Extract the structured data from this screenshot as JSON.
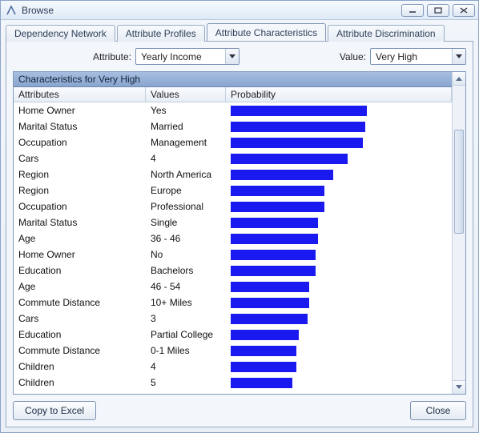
{
  "window": {
    "title": "Browse"
  },
  "tabs": [
    {
      "label": "Dependency Network"
    },
    {
      "label": "Attribute Profiles"
    },
    {
      "label": "Attribute Characteristics"
    },
    {
      "label": "Attribute Discrimination"
    }
  ],
  "controls": {
    "attribute_label": "Attribute:",
    "attribute_value": "Yearly Income",
    "value_label": "Value:",
    "value_value": "Very High"
  },
  "grid": {
    "caption": "Characteristics for Very High",
    "columns": {
      "attr": "Attributes",
      "val": "Values",
      "prob": "Probability"
    },
    "rows": [
      {
        "attr": "Home Owner",
        "val": "Yes",
        "prob": 64
      },
      {
        "attr": "Marital Status",
        "val": "Married",
        "prob": 63
      },
      {
        "attr": "Occupation",
        "val": "Management",
        "prob": 62
      },
      {
        "attr": "Cars",
        "val": "4",
        "prob": 55
      },
      {
        "attr": "Region",
        "val": "North America",
        "prob": 48
      },
      {
        "attr": "Region",
        "val": "Europe",
        "prob": 44
      },
      {
        "attr": "Occupation",
        "val": "Professional",
        "prob": 44
      },
      {
        "attr": "Marital Status",
        "val": "Single",
        "prob": 41
      },
      {
        "attr": "Age",
        "val": "36 - 46",
        "prob": 41
      },
      {
        "attr": "Home Owner",
        "val": "No",
        "prob": 40
      },
      {
        "attr": "Education",
        "val": "Bachelors",
        "prob": 40
      },
      {
        "attr": "Age",
        "val": "46 - 54",
        "prob": 37
      },
      {
        "attr": "Commute Distance",
        "val": "10+ Miles",
        "prob": 37
      },
      {
        "attr": "Cars",
        "val": "3",
        "prob": 36
      },
      {
        "attr": "Education",
        "val": "Partial College",
        "prob": 32
      },
      {
        "attr": "Commute Distance",
        "val": "0-1 Miles",
        "prob": 31
      },
      {
        "attr": "Children",
        "val": "4",
        "prob": 31
      },
      {
        "attr": "Children",
        "val": "5",
        "prob": 29
      }
    ]
  },
  "buttons": {
    "copy": "Copy to Excel",
    "close": "Close"
  },
  "colors": {
    "bar": "#1a1af0"
  }
}
